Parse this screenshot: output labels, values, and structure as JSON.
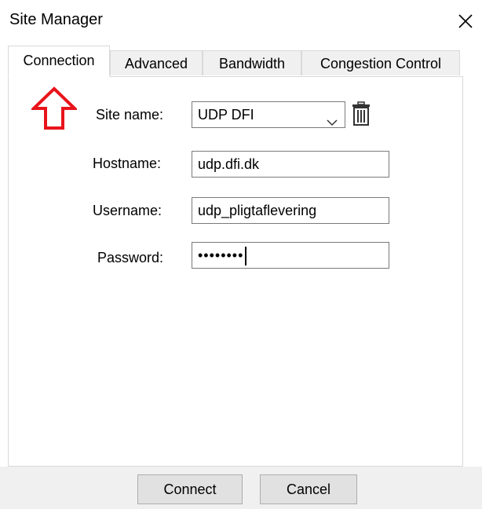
{
  "window": {
    "title": "Site Manager",
    "close_icon": "close-icon"
  },
  "tabs": [
    {
      "label": "Connection",
      "active": true
    },
    {
      "label": "Advanced",
      "active": false
    },
    {
      "label": "Bandwidth",
      "active": false
    },
    {
      "label": "Congestion Control",
      "active": false
    }
  ],
  "form": {
    "site_name_label": "Site name:",
    "site_name_value": "UDP DFI",
    "hostname_label": "Hostname:",
    "hostname_value": "udp.dfi.dk",
    "username_label": "Username:",
    "username_value": "udp_pligtaflevering",
    "password_label": "Password:",
    "password_value": "••••••••"
  },
  "buttons": {
    "connect_label": "Connect",
    "cancel_label": "Cancel"
  },
  "annotation": {
    "arrow_icon": "up-arrow-icon",
    "arrow_color": "#e8141b"
  },
  "colors": {
    "field_border": "#7a7a7a",
    "tab_border": "#d9d9d9",
    "button_bg": "#e1e1e1",
    "footer_bg": "#f0f0f0"
  }
}
